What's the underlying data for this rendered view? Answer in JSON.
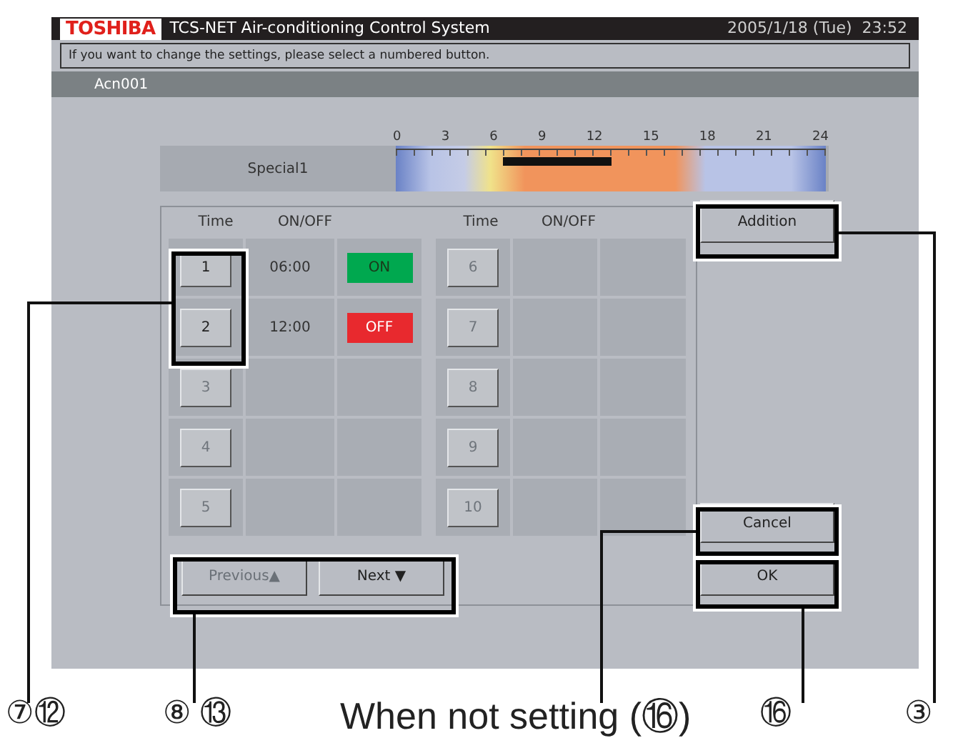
{
  "header": {
    "brand": "TOSHIBA",
    "title": "TCS-NET Air-conditioning Control System",
    "datetime": "2005/1/18 (Tue)  23:52"
  },
  "message": "If you want to change the settings, please select a numbered button.",
  "unit_name": "Acn001",
  "schedule": {
    "name": "Special1",
    "scale": [
      "0",
      "3",
      "6",
      "9",
      "12",
      "15",
      "18",
      "21",
      "24"
    ]
  },
  "tables": [
    {
      "columns": [
        "Time",
        "ON/OFF"
      ],
      "slots": [
        {
          "number": "1",
          "enabled": true,
          "time": "06:00",
          "state": "ON",
          "on": true
        },
        {
          "number": "2",
          "enabled": true,
          "time": "12:00",
          "state": "OFF",
          "on": false
        },
        {
          "number": "3",
          "enabled": false
        },
        {
          "number": "4",
          "enabled": false
        },
        {
          "number": "5",
          "enabled": false
        }
      ]
    },
    {
      "columns": [
        "Time",
        "ON/OFF"
      ],
      "slots": [
        {
          "number": "6",
          "enabled": false
        },
        {
          "number": "7",
          "enabled": false
        },
        {
          "number": "8",
          "enabled": false
        },
        {
          "number": "9",
          "enabled": false
        },
        {
          "number": "10",
          "enabled": false
        }
      ]
    }
  ],
  "nav": [
    {
      "label": "Previous▲",
      "disabled": true
    },
    {
      "label": "Next ▼",
      "disabled": false
    }
  ],
  "buttons": {
    "addition": "Addition",
    "cancel": "Cancel",
    "ok": "OK"
  },
  "callouts": [
    {
      "label": "⑦⑫"
    },
    {
      "label": "⑧ ⑬"
    },
    {
      "label": "When not setting (⑯)"
    },
    {
      "label": "⑯"
    },
    {
      "label": "③"
    }
  ]
}
